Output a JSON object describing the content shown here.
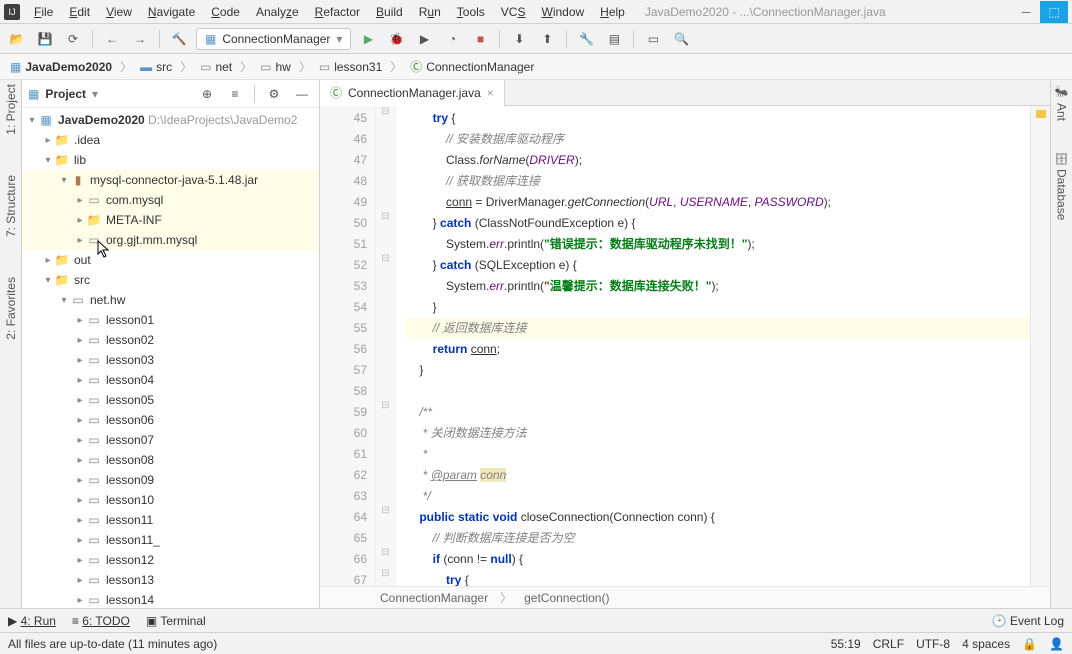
{
  "menu": {
    "file": "File",
    "edit": "Edit",
    "view": "View",
    "navigate": "Navigate",
    "code": "Code",
    "analyze": "Analyze",
    "refactor": "Refactor",
    "build": "Build",
    "run": "Run",
    "tools": "Tools",
    "vcs": "VCS",
    "window": "Window",
    "help": "Help"
  },
  "titlepath": "JavaDemo2020 - ...\\ConnectionManager.java",
  "runconfig": "ConnectionManager",
  "breadcrumbs": [
    "JavaDemo2020",
    "src",
    "net",
    "hw",
    "lesson31",
    "ConnectionManager"
  ],
  "proj": {
    "label": "Project",
    "root": "JavaDemo2020",
    "rootpath": "D:\\IdeaProjects\\JavaDemo2",
    "idea": ".idea",
    "lib": "lib",
    "jar": "mysql-connector-java-5.1.48.jar",
    "jar1": "com.mysql",
    "jar2": "META-INF",
    "jar3": "org.gjt.mm.mysql",
    "out": "out",
    "src": "src",
    "pkg": "net.hw",
    "lessons": [
      "lesson01",
      "lesson02",
      "lesson03",
      "lesson04",
      "lesson05",
      "lesson06",
      "lesson07",
      "lesson08",
      "lesson09",
      "lesson10",
      "lesson11",
      "lesson11_",
      "lesson12",
      "lesson13",
      "lesson14"
    ]
  },
  "tab": "ConnectionManager.java",
  "lines": [
    "45",
    "46",
    "47",
    "48",
    "49",
    "50",
    "51",
    "52",
    "53",
    "54",
    "55",
    "56",
    "57",
    "58",
    "59",
    "60",
    "61",
    "62",
    "63",
    "64",
    "65",
    "66",
    "67"
  ],
  "code": {
    "l45a": "try",
    " l45b": " {",
    "l46": "// 安装数据库驱动程序",
    "l47a": "Class.",
    "l47b": "forName",
    "l47c": "(",
    "l47d": "DRIVER",
    "l47e": ");",
    "l48": "// 获取数据库连接",
    "l49a": "conn",
    "l49b": " = DriverManager.",
    "l49c": "getConnection",
    "l49d": "(",
    "l49e": "URL",
    "l49f": ", ",
    "l49g": "USERNAME",
    "l49h": ", ",
    "l49i": "PASSWORD",
    "l49j": ");",
    "l50a": "} ",
    "l50b": "catch",
    "l50c": " (ClassNotFoundException e) {",
    "l51a": "System.",
    "l51b": "err",
    "l51c": ".println(",
    "l51d": "\"错误提示：数据库驱动程序未找到！\"",
    "l51e": ");",
    "l52a": "} ",
    "l52b": "catch",
    "l52c": " (SQLException e) {",
    "l53a": "System.",
    "l53b": "err",
    "l53c": ".println(",
    "l53d": "\"温馨提示：数据库连接失败！\"",
    "l53e": ");",
    "l54": "}",
    "l55": "// 返回数据库连接",
    "l56a": "return ",
    "l56b": "conn",
    "l56c": ";",
    "l57": "}",
    "l59": "/**",
    "l60": " * 关闭数据连接方法",
    "l61": " *",
    "l62a": " * ",
    "l62b": "@param",
    "l62c": " ",
    "l62d": "conn",
    "l63": " */",
    "l64a": "public static void",
    "l64b": " closeConnection(Connection conn) {",
    "l65": "// 判断数据库连接是否为空",
    "l66a": "if",
    "l66b": " (conn != ",
    "l66c": "null",
    "l66d": ") {",
    "l67a": "try",
    " l67b": " {"
  },
  "bcrumb1": "ConnectionManager",
  "bcrumb2": "getConnection()",
  "bottom": {
    "run": "4: Run",
    "todo": "6: TODO",
    "term": "Terminal",
    "eventlog": "Event Log"
  },
  "status": {
    "msg": "All files are up-to-date (11 minutes ago)",
    "pos": "55:19",
    "eol": "CRLF",
    "enc": "UTF-8",
    "indent": "4 spaces"
  },
  "side": {
    "project": "1: Project",
    "structure": "7: Structure",
    "fav": "2: Favorites",
    "ant": "Ant",
    "db": "Database"
  }
}
